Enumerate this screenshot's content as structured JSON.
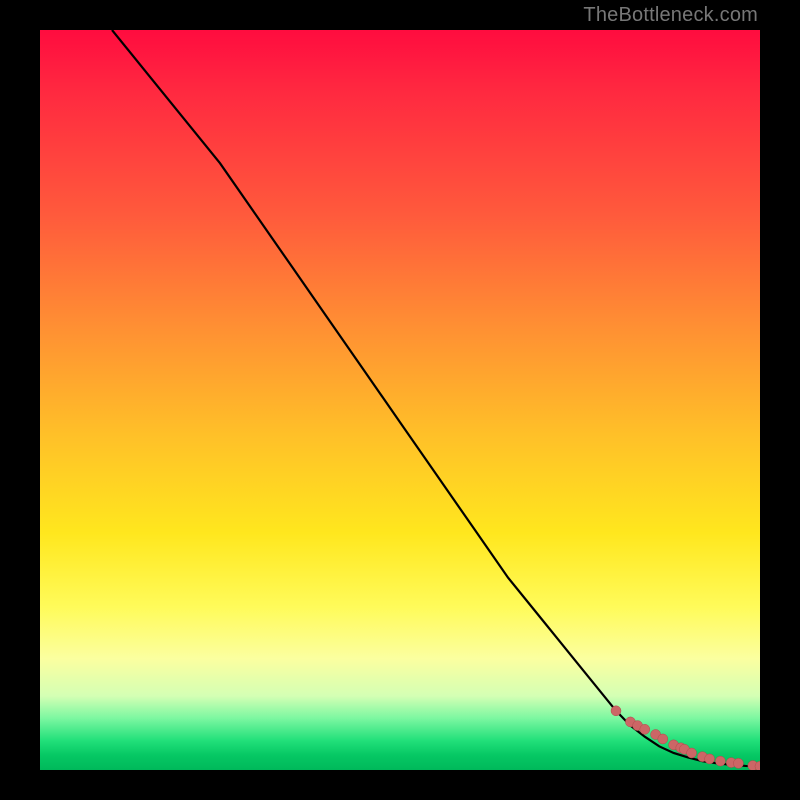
{
  "attribution": "TheBottleneck.com",
  "colors": {
    "line": "#000000",
    "marker_fill": "#cc6666",
    "marker_stroke": "#b04a4a"
  },
  "chart_data": {
    "type": "line",
    "title": "",
    "xlabel": "",
    "ylabel": "",
    "xlim": [
      0,
      100
    ],
    "ylim": [
      0,
      100
    ],
    "series": [
      {
        "name": "curve",
        "x": [
          10,
          15,
          20,
          25,
          30,
          35,
          40,
          45,
          50,
          55,
          60,
          65,
          70,
          75,
          80,
          82,
          84,
          86,
          88,
          90,
          92,
          94,
          96,
          98,
          100
        ],
        "y": [
          100,
          94,
          88,
          82,
          75,
          68,
          61,
          54,
          47,
          40,
          33,
          26,
          20,
          14,
          8,
          6,
          4.5,
          3.2,
          2.3,
          1.7,
          1.2,
          0.9,
          0.7,
          0.55,
          0.5
        ]
      }
    ],
    "markers": {
      "name": "tail-points",
      "x": [
        80,
        82,
        83,
        84,
        85.5,
        86.5,
        88,
        89,
        89.5,
        90.5,
        92,
        93,
        94.5,
        96,
        97,
        99,
        100
      ],
      "y": [
        8,
        6.5,
        6,
        5.5,
        4.8,
        4.2,
        3.4,
        3.0,
        2.8,
        2.3,
        1.8,
        1.5,
        1.2,
        1.0,
        0.9,
        0.6,
        0.5
      ],
      "r": [
        5,
        5,
        5,
        5,
        5,
        5,
        5,
        5,
        5,
        5,
        5,
        5,
        5,
        5,
        5,
        5,
        5
      ]
    }
  }
}
